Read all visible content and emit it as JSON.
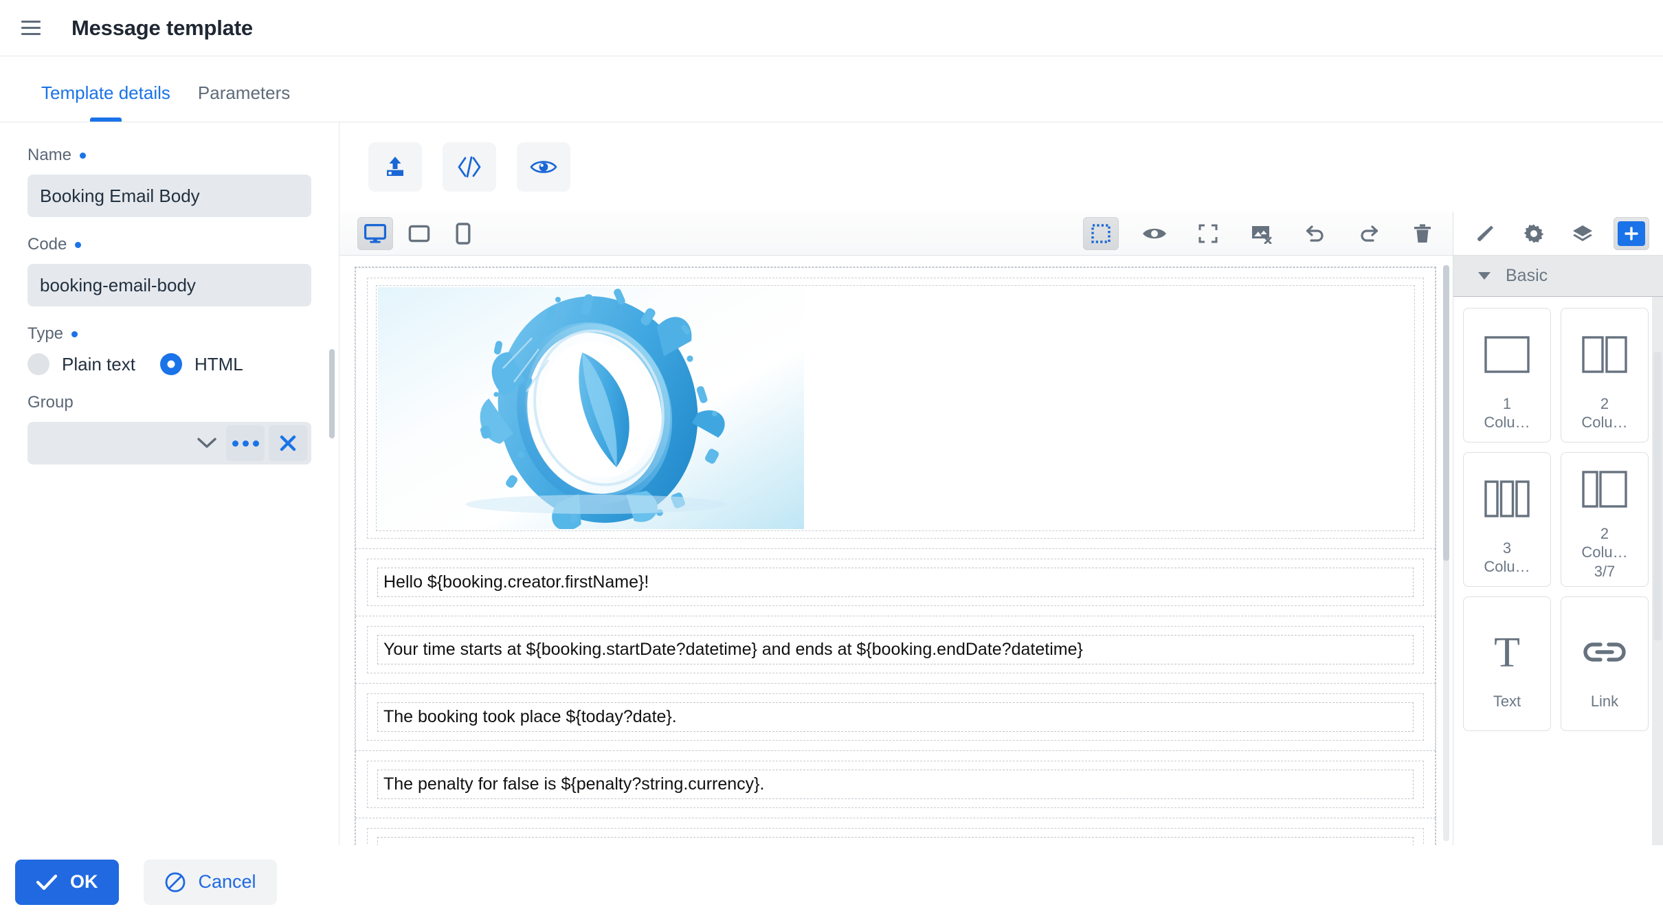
{
  "header": {
    "menu_icon": "hamburger-menu-icon",
    "title": "Message template"
  },
  "tabs": [
    {
      "label": "Template details",
      "active": true
    },
    {
      "label": "Parameters",
      "active": false
    }
  ],
  "form": {
    "name": {
      "label": "Name",
      "required": true,
      "value": "Booking Email Body"
    },
    "code": {
      "label": "Code",
      "required": true,
      "value": "booking-email-body"
    },
    "type": {
      "label": "Type",
      "required": true,
      "options": [
        {
          "label": "Plain text",
          "selected": false
        },
        {
          "label": "HTML",
          "selected": true
        }
      ]
    },
    "group": {
      "label": "Group",
      "required": false,
      "value": "",
      "placeholder": "",
      "dropdown_icon": "chevron-down-icon",
      "more_icon": "ellipsis-icon",
      "clear_icon": "close-x-icon"
    }
  },
  "top_actions": [
    {
      "name": "upload-template-button",
      "icon": "upload-icon"
    },
    {
      "name": "edit-source-button",
      "icon": "code-brackets-icon"
    },
    {
      "name": "preview-template-button",
      "icon": "eye-icon"
    }
  ],
  "editor_toolbar": {
    "devices": [
      {
        "name": "desktop",
        "icon": "desktop-icon",
        "active": true
      },
      {
        "name": "tablet",
        "icon": "tablet-icon",
        "active": false
      },
      {
        "name": "mobile",
        "icon": "mobile-icon",
        "active": false
      }
    ],
    "tools": [
      {
        "name": "toggle-borders",
        "icon": "dashed-square-icon",
        "active": true
      },
      {
        "name": "preview",
        "icon": "eye-icon",
        "active": false
      },
      {
        "name": "fullscreen",
        "icon": "fullscreen-icon",
        "active": false
      },
      {
        "name": "toggle-images",
        "icon": "image-off-icon",
        "active": false
      },
      {
        "name": "undo",
        "icon": "undo-arrow-icon",
        "active": false
      },
      {
        "name": "redo",
        "icon": "redo-arrow-icon",
        "active": false
      },
      {
        "name": "delete",
        "icon": "trash-icon",
        "active": false
      }
    ]
  },
  "email": {
    "hero_alt": "blue abstract swirl graphic",
    "lines": [
      "Hello ${booking.creator.firstName}!",
      "Your time starts at ${booking.startDate?datetime} and ends at ${booking.endDate?datetime}",
      "The booking took place ${today?date}.",
      "The penalty for false is ${penalty?string.currency}."
    ]
  },
  "blocks_panel": {
    "tabs": [
      {
        "name": "style-manager",
        "icon": "paint-brush-icon",
        "active": false
      },
      {
        "name": "settings",
        "icon": "gear-icon",
        "active": false
      },
      {
        "name": "layer-manager",
        "icon": "layers-icon",
        "active": false
      },
      {
        "name": "blocks",
        "icon": "plus-icon",
        "active": true
      }
    ],
    "category": "Basic",
    "items": [
      {
        "label": "1\nColu…",
        "icon": "one-column-icon"
      },
      {
        "label": "2\nColu…",
        "icon": "two-column-icon"
      },
      {
        "label": "3\nColu…",
        "icon": "three-column-icon"
      },
      {
        "label": "2\nColu…\n3/7",
        "icon": "two-column-37-icon"
      },
      {
        "label": "Text",
        "icon": "text-t-icon"
      },
      {
        "label": "Link",
        "icon": "link-chain-icon"
      }
    ]
  },
  "footer": {
    "ok_label": "OK",
    "ok_icon": "check-icon",
    "cancel_label": "Cancel",
    "cancel_icon": "block-circle-icon"
  },
  "colors": {
    "accent": "#1a73e8",
    "ok_button": "#2069e0",
    "label_gray": "#5b6776",
    "field_bg": "#e5e9ed"
  }
}
